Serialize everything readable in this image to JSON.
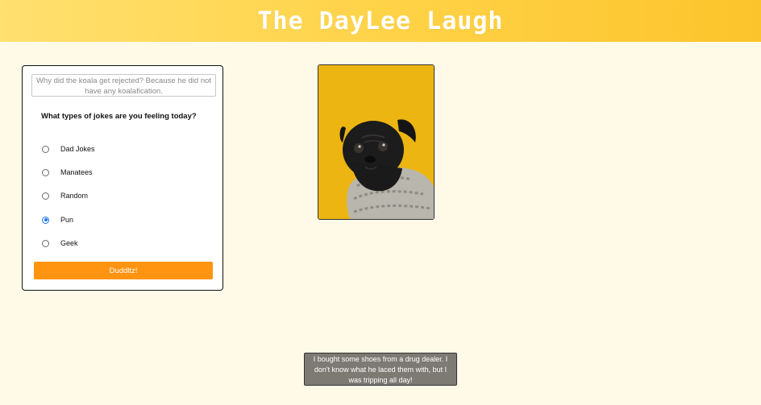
{
  "header": {
    "title": "The DayLee Laugh"
  },
  "joke_form": {
    "joke_text": "Why did the koala get rejected? Because he did not have any koalafication.",
    "question": "What types of jokes are you feeling today?",
    "options": [
      {
        "label": "Dad Jokes",
        "selected": false
      },
      {
        "label": "Manatees",
        "selected": false
      },
      {
        "label": "Random",
        "selected": false
      },
      {
        "label": "Pun",
        "selected": true
      },
      {
        "label": "Geek",
        "selected": false
      }
    ],
    "submit_label": "Duddltz!",
    "submit_color": "#ff9410"
  },
  "image": {
    "subject": "black pug in a grey knit sweater on a yellow background",
    "background_color": "#ecb511"
  },
  "punchline": {
    "text": "I bought some shoes from a drug dealer. I don't know what he laced them with, but I was tripping all day!"
  },
  "colors": {
    "page_background": "#fff9e8",
    "header_gradient_start": "#ffe070",
    "header_gradient_end": "#fcc42c",
    "radio_selected": "#1a73e8"
  }
}
